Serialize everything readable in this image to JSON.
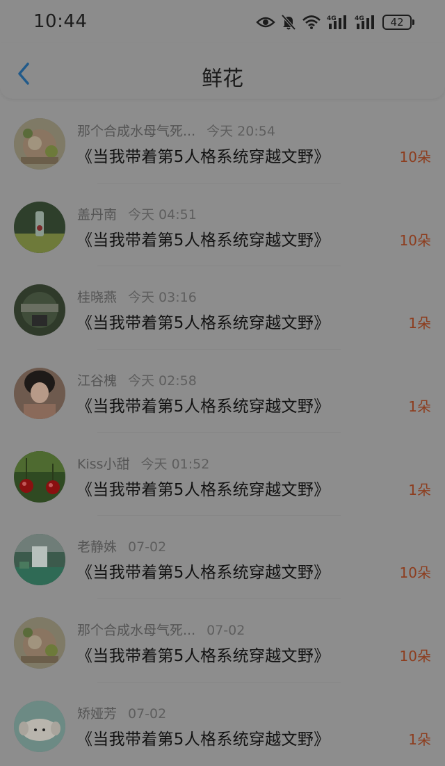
{
  "status_bar": {
    "time": "10:44",
    "battery": "42",
    "icons": [
      "eye-icon",
      "bell-off-icon",
      "wifi-icon",
      "signal-4g-icon",
      "signal-4g-icon",
      "battery-icon"
    ]
  },
  "header": {
    "title": "鲜花",
    "back_icon": "chevron-left-icon"
  },
  "colors": {
    "amount": "#8d3d1e",
    "back": "#215a8a"
  },
  "items": [
    {
      "name": "那个合成水母气死...",
      "time": "今天 20:54",
      "book": "《当我带着第5人格系统穿越文野》",
      "amount": "10朵"
    },
    {
      "name": "盖丹南",
      "time": "今天 04:51",
      "book": "《当我带着第5人格系统穿越文野》",
      "amount": "10朵"
    },
    {
      "name": "桂晓燕",
      "time": "今天 03:16",
      "book": "《当我带着第5人格系统穿越文野》",
      "amount": "1朵"
    },
    {
      "name": "江谷槐",
      "time": "今天 02:58",
      "book": "《当我带着第5人格系统穿越文野》",
      "amount": "1朵"
    },
    {
      "name": "Kiss小甜",
      "time": "今天 01:52",
      "book": "《当我带着第5人格系统穿越文野》",
      "amount": "1朵"
    },
    {
      "name": "老静姝",
      "time": "07-02",
      "book": "《当我带着第5人格系统穿越文野》",
      "amount": "10朵"
    },
    {
      "name": "那个合成水母气死...",
      "time": "07-02",
      "book": "《当我带着第5人格系统穿越文野》",
      "amount": "10朵"
    },
    {
      "name": "矫娅芳",
      "time": "07-02",
      "book": "《当我带着第5人格系统穿越文野》",
      "amount": "1朵"
    }
  ]
}
